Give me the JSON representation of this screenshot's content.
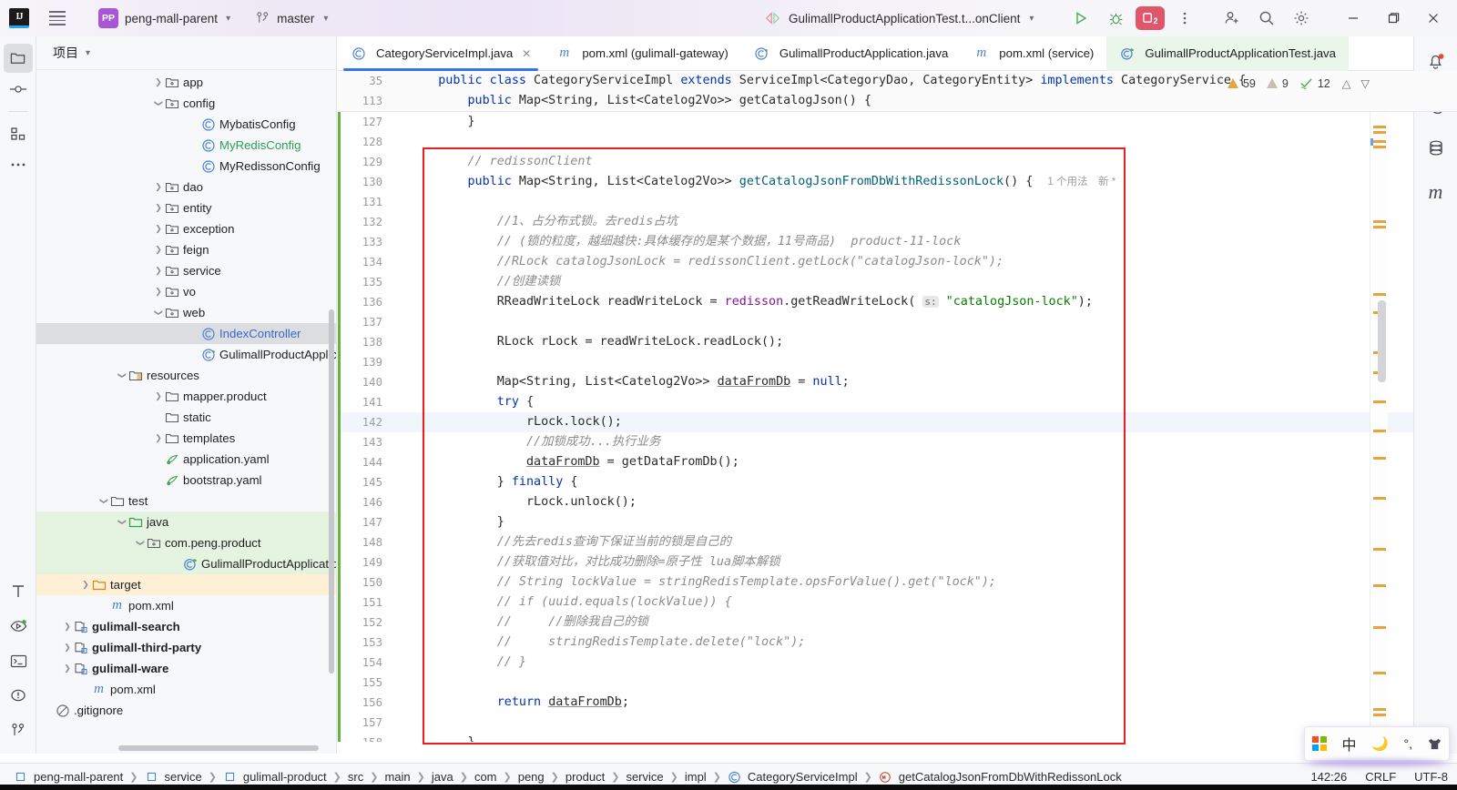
{
  "titlebar": {
    "logo_text": "IJ",
    "project_badge": "PP",
    "project_name": "peng-mall-parent",
    "branch_name": "master",
    "run_config": "GulimallProductApplicationTest.t...onClient",
    "debug_badge_count": "2"
  },
  "project_panel": {
    "title": "项目",
    "tree": [
      {
        "indent": 6,
        "arrow": "collapsed",
        "icon": "folder-icon",
        "label": "app"
      },
      {
        "indent": 6,
        "arrow": "expanded",
        "icon": "folder-icon",
        "label": "config"
      },
      {
        "indent": 8,
        "arrow": "none",
        "icon": "class-icon",
        "label": "MybatisConfig"
      },
      {
        "indent": 8,
        "arrow": "none",
        "icon": "class-icon",
        "label": "MyRedisConfig",
        "color": "green"
      },
      {
        "indent": 8,
        "arrow": "none",
        "icon": "class-icon",
        "label": "MyRedissonConfig"
      },
      {
        "indent": 6,
        "arrow": "collapsed",
        "icon": "folder-icon",
        "label": "dao"
      },
      {
        "indent": 6,
        "arrow": "collapsed",
        "icon": "folder-icon",
        "label": "entity"
      },
      {
        "indent": 6,
        "arrow": "collapsed",
        "icon": "folder-icon",
        "label": "exception"
      },
      {
        "indent": 6,
        "arrow": "collapsed",
        "icon": "folder-icon",
        "label": "feign"
      },
      {
        "indent": 6,
        "arrow": "collapsed",
        "icon": "folder-icon",
        "label": "service"
      },
      {
        "indent": 6,
        "arrow": "collapsed",
        "icon": "folder-icon",
        "label": "vo"
      },
      {
        "indent": 6,
        "arrow": "expanded",
        "icon": "folder-icon",
        "label": "web"
      },
      {
        "indent": 8,
        "arrow": "none",
        "icon": "class-icon",
        "label": "IndexController",
        "state": "selected",
        "color": "blue"
      },
      {
        "indent": 8,
        "arrow": "none",
        "icon": "spring-class-icon",
        "label": "GulimallProductApplicatio"
      },
      {
        "indent": 4,
        "arrow": "expanded",
        "icon": "resources-folder-icon",
        "label": "resources"
      },
      {
        "indent": 6,
        "arrow": "collapsed",
        "icon": "plain-folder-icon",
        "label": "mapper.product"
      },
      {
        "indent": 6,
        "arrow": "none",
        "icon": "plain-folder-icon",
        "label": "static"
      },
      {
        "indent": 6,
        "arrow": "collapsed",
        "icon": "plain-folder-icon",
        "label": "templates"
      },
      {
        "indent": 6,
        "arrow": "none",
        "icon": "yaml-icon",
        "label": "application.yaml"
      },
      {
        "indent": 6,
        "arrow": "none",
        "icon": "yaml-icon",
        "label": "bootstrap.yaml"
      },
      {
        "indent": 3,
        "arrow": "expanded",
        "icon": "plain-folder-icon",
        "label": "test"
      },
      {
        "indent": 4,
        "arrow": "expanded",
        "icon": "test-source-folder-icon",
        "label": "java",
        "state": "green"
      },
      {
        "indent": 5,
        "arrow": "expanded",
        "icon": "package-icon",
        "label": "com.peng.product",
        "state": "green"
      },
      {
        "indent": 7,
        "arrow": "none",
        "icon": "spring-test-class-icon",
        "label": "GulimallProductApplicatio",
        "state": "green"
      },
      {
        "indent": 2,
        "arrow": "collapsed",
        "icon": "target-folder-icon",
        "label": "target",
        "state": "orange"
      },
      {
        "indent": 3,
        "arrow": "none",
        "icon": "maven-icon",
        "label": "pom.xml"
      },
      {
        "indent": 1,
        "arrow": "collapsed",
        "icon": "module-icon",
        "label": "gulimall-search",
        "bold": true
      },
      {
        "indent": 1,
        "arrow": "collapsed",
        "icon": "module-icon",
        "label": "gulimall-third-party",
        "bold": true
      },
      {
        "indent": 1,
        "arrow": "collapsed",
        "icon": "module-icon",
        "label": "gulimall-ware",
        "bold": true
      },
      {
        "indent": 2,
        "arrow": "none",
        "icon": "maven-icon",
        "label": "pom.xml"
      },
      {
        "indent": 0,
        "arrow": "none",
        "icon": "gitignore-icon",
        "label": ".gitignore"
      }
    ]
  },
  "tabs": [
    {
      "label": "CategoryServiceImpl.java",
      "icon": "java-class-icon",
      "active": true,
      "closable": true
    },
    {
      "label": "pom.xml (gulimall-gateway)",
      "icon": "maven-icon",
      "active": false
    },
    {
      "label": "GulimallProductApplication.java",
      "icon": "spring-class-icon",
      "active": false
    },
    {
      "label": "pom.xml (service)",
      "icon": "maven-icon",
      "active": false
    },
    {
      "label": "GulimallProductApplicationTest.java",
      "icon": "spring-test-class-icon",
      "active": false,
      "highlight": true
    }
  ],
  "inspection_widget": {
    "errors": "59",
    "warnings": "9",
    "checks": "12"
  },
  "editor": {
    "sticky_lines": [
      {
        "num": "35",
        "html": "    <span class='kw'>public class</span> CategoryServiceImpl <span class='kw'>extends</span> ServiceImpl&lt;CategoryDao, CategoryEntity&gt; <span class='kw'>implements</span> CategoryService {"
      },
      {
        "num": "113",
        "html": "        <span class='kw'>public</span> Map&lt;String, List&lt;Catelog2Vo&gt;&gt; getCatalogJson() {"
      }
    ],
    "lines": [
      {
        "num": "127",
        "html": "        }"
      },
      {
        "num": "128",
        "html": ""
      },
      {
        "num": "129",
        "html": "        <span class='cm'>// redissonClient</span>"
      },
      {
        "num": "130",
        "html": "        <span class='kw'>public</span> Map&lt;String, List&lt;Catelog2Vo&gt;&gt; <span style='color:#00627a'>getCatalogJsonFromDbWithRedissonLock</span>() {  <span class='hint'>1 个用法　新 *</span>"
      },
      {
        "num": "131",
        "html": ""
      },
      {
        "num": "132",
        "html": "            <span class='cm'>//1、占分布式锁。去redis占坑</span>"
      },
      {
        "num": "133",
        "html": "            <span class='cm'>// (锁的粒度，越细越快:具体缓存的是某个数据，11号商品)  product-11-lock</span>"
      },
      {
        "num": "134",
        "html": "            <span class='cm'>//RLock catalogJsonLock = redissonClient.getLock(\"catalogJson-lock\");</span>"
      },
      {
        "num": "135",
        "html": "            <span class='cm'>//创建读锁</span>"
      },
      {
        "num": "136",
        "html": "            RReadWriteLock readWriteLock = <span class='fld'>redisson</span>.getReadWriteLock( <span class='pnm'>s:</span> <span class='str'>\"catalogJson-lock\"</span>);"
      },
      {
        "num": "137",
        "html": ""
      },
      {
        "num": "138",
        "html": "            RLock rLock = readWriteLock.readLock();"
      },
      {
        "num": "139",
        "html": ""
      },
      {
        "num": "140",
        "html": "            Map&lt;String, List&lt;Catelog2Vo&gt;&gt; <span class='und'>dataFromDb</span> = <span class='kw'>null</span>;"
      },
      {
        "num": "141",
        "html": "            <span class='kw'>try</span> {"
      },
      {
        "num": "142",
        "html": "                rLock.lock();",
        "highlight": true
      },
      {
        "num": "143",
        "html": "                <span class='cm'>//加锁成功...执行业务</span>"
      },
      {
        "num": "144",
        "html": "                <span class='und'>dataFromDb</span> = getDataFromDb();"
      },
      {
        "num": "145",
        "html": "            } <span class='kw'>finally</span> {"
      },
      {
        "num": "146",
        "html": "                rLock.unlock();"
      },
      {
        "num": "147",
        "html": "            }"
      },
      {
        "num": "148",
        "html": "            <span class='cm'>//先去redis查询下保证当前的锁是自己的</span>"
      },
      {
        "num": "149",
        "html": "            <span class='cm'>//获取值对比，对比成功删除=原子性 lua脚本解锁</span>"
      },
      {
        "num": "150",
        "html": "            <span class='cm'>// String lockValue = stringRedisTemplate.opsForValue().get(\"lock\");</span>"
      },
      {
        "num": "151",
        "html": "            <span class='cm'>// if (uuid.equals(lockValue)) {</span>"
      },
      {
        "num": "152",
        "html": "            <span class='cm'>//     //删除我自己的锁</span>"
      },
      {
        "num": "153",
        "html": "            <span class='cm'>//     stringRedisTemplate.delete(\"lock\");</span>"
      },
      {
        "num": "154",
        "html": "            <span class='cm'>// }</span>"
      },
      {
        "num": "155",
        "html": ""
      },
      {
        "num": "156",
        "html": "            <span class='kw'>return</span> <span class='und'>dataFromDb</span>;"
      },
      {
        "num": "157",
        "html": ""
      },
      {
        "num": "158",
        "html": "        }"
      }
    ]
  },
  "statusbar": {
    "breadcrumbs": [
      {
        "label": "peng-mall-parent",
        "icon": "module-square-icon"
      },
      {
        "label": "service",
        "icon": "module-square-icon"
      },
      {
        "label": "gulimall-product",
        "icon": "module-square-icon"
      },
      {
        "label": "src",
        "icon": "none"
      },
      {
        "label": "main",
        "icon": "none"
      },
      {
        "label": "java",
        "icon": "none"
      },
      {
        "label": "com",
        "icon": "none"
      },
      {
        "label": "peng",
        "icon": "none"
      },
      {
        "label": "product",
        "icon": "none"
      },
      {
        "label": "service",
        "icon": "none"
      },
      {
        "label": "impl",
        "icon": "none"
      },
      {
        "label": "CategoryServiceImpl",
        "icon": "class-icon"
      },
      {
        "label": "getCatalogJsonFromDbWithRedissonLock",
        "icon": "method-icon"
      }
    ],
    "caret": "142:26",
    "line_separator": "CRLF",
    "encoding": "UTF-8"
  },
  "ime_popup": {
    "items": [
      "windows-logo-icon",
      "中",
      "moon-icon",
      "punctuation-icon",
      "keyboard-skin-icon"
    ]
  },
  "colors": {
    "accent": "#3574f0",
    "keyword": "#0033b3",
    "string": "#047d00",
    "comment": "#8c8c8c",
    "field": "#871094",
    "annotation_box": "#f21c1c",
    "selection": "#dcdde1",
    "test_source": "#e4f4e0",
    "target_folder": "#fdf0d5"
  }
}
